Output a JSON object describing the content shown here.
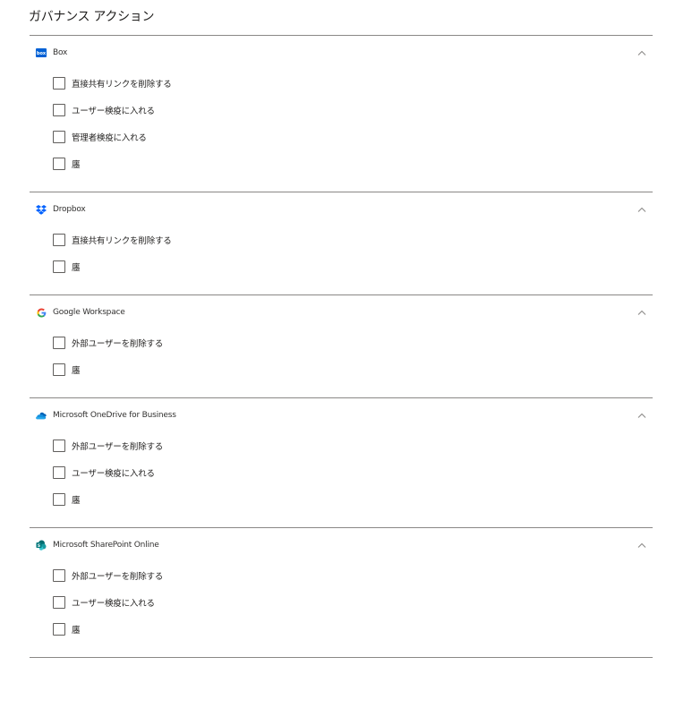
{
  "title": "ガバナンス アクション",
  "sections": [
    {
      "name": "Box",
      "icon": "box-icon",
      "expanded": true,
      "options": [
        {
          "label": "直接共有リンクを削除する",
          "checked": false
        },
        {
          "label": "ユーザー検疫に入れる",
          "checked": false
        },
        {
          "label": "管理者検疫に入れる",
          "checked": false
        },
        {
          "label": "廛",
          "checked": false
        }
      ]
    },
    {
      "name": "Dropbox",
      "icon": "dropbox-icon",
      "expanded": true,
      "options": [
        {
          "label": "直接共有リンクを削除する",
          "checked": false
        },
        {
          "label": "廛",
          "checked": false
        }
      ]
    },
    {
      "name": "Google Workspace",
      "icon": "google-icon",
      "expanded": true,
      "options": [
        {
          "label": "外部ユーザーを削除する",
          "checked": false
        },
        {
          "label": "廛",
          "checked": false
        }
      ]
    },
    {
      "name": "Microsoft OneDrive for Business",
      "icon": "onedrive-icon",
      "expanded": true,
      "options": [
        {
          "label": "外部ユーザーを削除する",
          "checked": false
        },
        {
          "label": "ユーザー検疫に入れる",
          "checked": false
        },
        {
          "label": "廛",
          "checked": false
        }
      ]
    },
    {
      "name": "Microsoft SharePoint Online",
      "icon": "sharepoint-icon",
      "expanded": true,
      "options": [
        {
          "label": "外部ユーザーを削除する",
          "checked": false
        },
        {
          "label": "ユーザー検疫に入れる",
          "checked": false
        },
        {
          "label": "廛",
          "checked": false
        }
      ]
    }
  ],
  "colors": {
    "box": "#0061d5",
    "dropbox": "#0061fe",
    "onedrive": "#0364b8",
    "sharepoint": "#038387",
    "divider": "#8a8886"
  }
}
